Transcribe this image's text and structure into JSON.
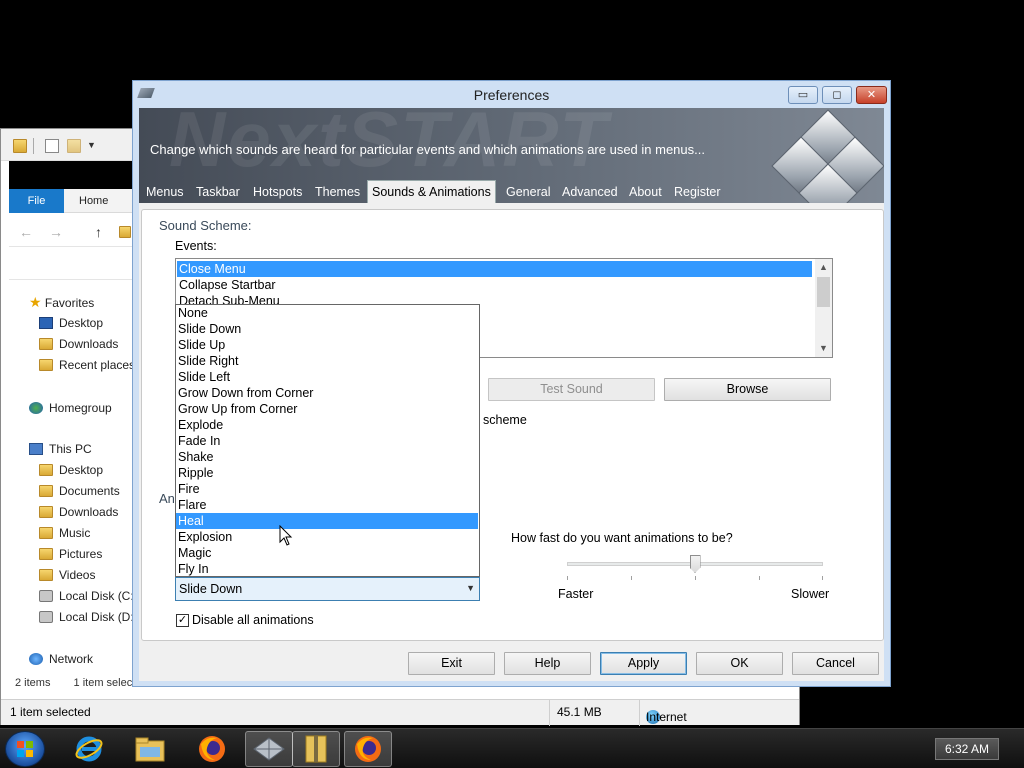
{
  "explorer": {
    "tabs": {
      "file": "File",
      "home": "Home"
    },
    "nav": {
      "favorites": "Favorites",
      "fav_items": [
        "Desktop",
        "Downloads",
        "Recent places"
      ],
      "homegroup": "Homegroup",
      "this_pc": "This PC",
      "pc_items": [
        "Desktop",
        "Documents",
        "Downloads",
        "Music",
        "Pictures",
        "Videos",
        "Local Disk (C:",
        "Local Disk (D:"
      ],
      "network": "Network"
    },
    "status": {
      "items_count": "2 items",
      "items_selected": "1 item selected",
      "bottom_selected": "1 item selected",
      "size": "45.1 MB",
      "zone": "Internet"
    }
  },
  "prefs": {
    "title": "Preferences",
    "banner_description": "Change which sounds are heard for particular events and which animations are used in menus...",
    "banner_watermark": "NextSTART",
    "tabs": [
      "Menus",
      "Taskbar",
      "Hotspots",
      "Themes",
      "Sounds & Animations",
      "General",
      "Advanced",
      "About",
      "Register"
    ],
    "active_tab": "Sounds & Animations",
    "sound_scheme_label": "Sound Scheme:",
    "events_label": "Events:",
    "events": [
      "Close Menu",
      "Collapse Startbar",
      "Detach Sub-Menu"
    ],
    "selected_event": "Close Menu",
    "test_sound": "Test Sound",
    "browse": "Browse",
    "scheme_fragment": "scheme",
    "animations_fragment": "An",
    "animation_options": [
      "None",
      "Slide Down",
      "Slide Up",
      "Slide Right",
      "Slide Left",
      "Grow Down from Corner",
      "Grow Up from Corner",
      "Explode",
      "Fade In",
      "Shake",
      "Ripple",
      "Fire",
      "Flare",
      "Heal",
      "Explosion",
      "Magic",
      "Fly In"
    ],
    "highlighted_option": "Heal",
    "combo_value": "Slide Down",
    "speed_question": "How fast do you want animations to be?",
    "speed_faster": "Faster",
    "speed_slower": "Slower",
    "speed_level": 0.5,
    "disable_animations": "Disable all animations",
    "disable_animations_checked": true,
    "buttons": {
      "exit": "Exit",
      "help": "Help",
      "apply": "Apply",
      "ok": "OK",
      "cancel": "Cancel"
    }
  },
  "taskbar": {
    "clock": "6:32 AM",
    "apps": [
      "start-orb",
      "internet-explorer-icon",
      "file-explorer-icon",
      "firefox-icon",
      "nextstart-icon",
      "archive-icon",
      "firefox-icon"
    ]
  },
  "colors": {
    "selection": "#3399ff",
    "dialog_frame": "#cfe0f4",
    "banner": "#5a626d",
    "explorer_file_tab": "#1979ca"
  }
}
